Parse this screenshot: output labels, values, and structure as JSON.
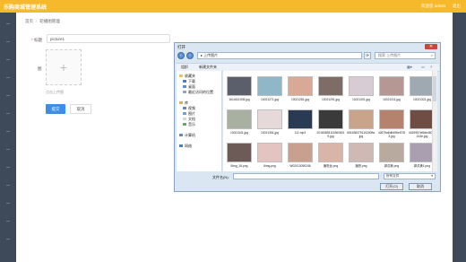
{
  "app": {
    "brand": "乐购商城管理系统",
    "user_greeting": "欢迎您 admin",
    "logout_label": "退出"
  },
  "breadcrumb": [
    "首页",
    "轮播图管理"
  ],
  "form": {
    "title_label": "标题",
    "title_value": "picture1",
    "image_label": "图",
    "upload_hint": "点击上传图",
    "save_label": "提交",
    "cancel_label": "取消"
  },
  "dialog": {
    "title": "打开",
    "address": "上传图片",
    "search_placeholder": "搜索 上传图片",
    "toolbar": {
      "organize": "组织",
      "new_folder": "新建文件夹"
    },
    "nav": {
      "favorites": "收藏夹",
      "downloads": "下载",
      "desktop": "桌面",
      "recent": "最近访问的位置",
      "libraries": "库",
      "videos": "视频",
      "pictures": "图片",
      "documents": "文档",
      "music": "音乐",
      "computer": "计算机",
      "network": "网络"
    },
    "files": [
      {
        "name": "1614611005.jpg",
        "color": "#5a5f6b"
      },
      {
        "name": "10021271.jpg",
        "color": "#8fb7c7"
      },
      {
        "name": "10021281.jpg",
        "color": "#d9a995"
      },
      {
        "name": "10021291.jpg",
        "color": "#7d6d66"
      },
      {
        "name": "10021301.jpg",
        "color": "#d8ccd4"
      },
      {
        "name": "10021311.jpg",
        "color": "#b59894"
      },
      {
        "name": "10021321.jpg",
        "color": "#9ea9b1"
      },
      {
        "name": "10021341.jpg",
        "color": "#a7b0a1"
      },
      {
        "name": "10021351.jpg",
        "color": "#e6d9da"
      },
      {
        "name": "111.mp3",
        "color": "#2a3a52"
      },
      {
        "name": "201808281153608019.jpg",
        "color": "#3a3a3a"
      },
      {
        "name": "651638379110240ffa.jpg",
        "color": "#c9a48b"
      },
      {
        "name": "42679a8d6495ef2783.jpg",
        "color": "#b5836d"
      },
      {
        "name": "4425957ef6db46017144e.jpg",
        "color": "#6f4d44"
      },
      {
        "name": "6img_16.png",
        "color": "#6d5b57"
      },
      {
        "name": "6img.png",
        "color": "#e3c4c1"
      },
      {
        "name": "W02013090246",
        "color": "#c7a08f"
      },
      {
        "name": "廉恐龙.png",
        "color": "#d9b5a8"
      },
      {
        "name": "廉恐.png",
        "color": "#cfb9b4"
      },
      {
        "name": "郭洪美.png",
        "color": "#b9aa9f"
      },
      {
        "name": "郭洪美1.png",
        "color": "#a99fb0"
      }
    ],
    "filename_label": "文件名(N):",
    "filetype_value": "所有文件",
    "open_label": "打开(O)",
    "cancel_label": "取消"
  }
}
